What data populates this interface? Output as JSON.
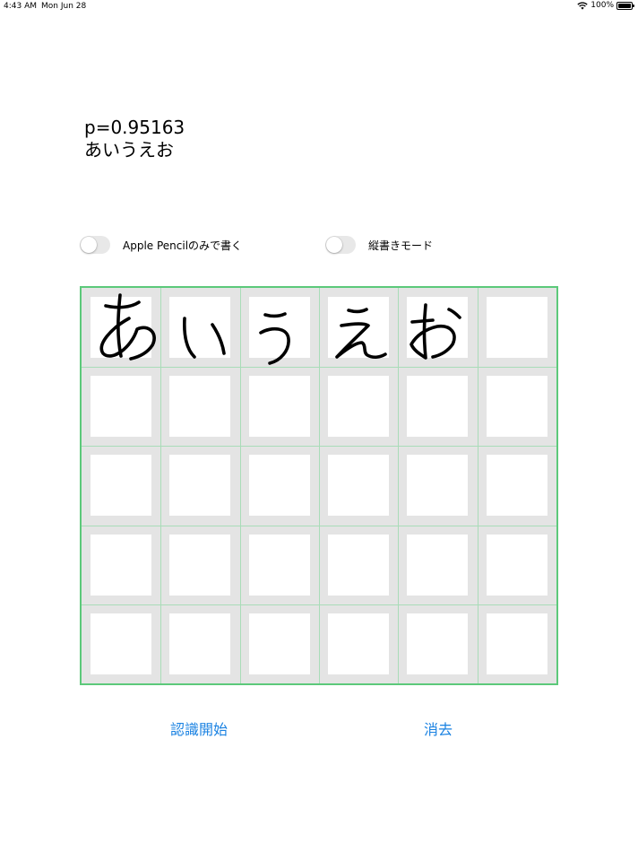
{
  "status_bar": {
    "time": "4:43 AM",
    "date": "Mon Jun 28",
    "battery": "100%",
    "battery_level": 1.0
  },
  "result": {
    "probability": "p=0.95163",
    "text": "あいうえお"
  },
  "toggles": [
    {
      "label": "Apple Pencilのみで書く",
      "on": false
    },
    {
      "label": "縦書きモード",
      "on": false
    }
  ],
  "grid": {
    "columns": 6,
    "rows": 5,
    "border_color": "#5cc97a",
    "ink_color": "#000000"
  },
  "buttons": {
    "recognize": "認識開始",
    "clear": "消去"
  },
  "colors": {
    "accent": "#1a82e2"
  }
}
